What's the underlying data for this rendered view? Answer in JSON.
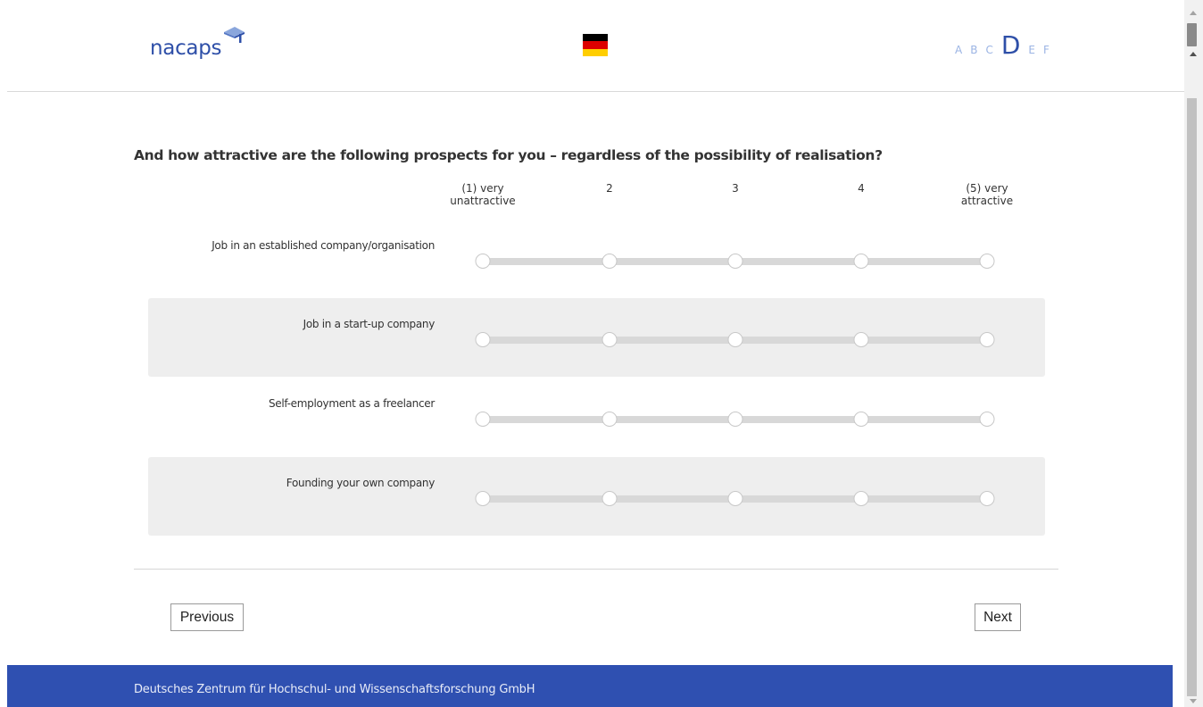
{
  "header": {
    "logo_text": "nacaps",
    "sections": [
      "A",
      "B",
      "C",
      "D",
      "E",
      "F"
    ],
    "active_section": "D",
    "flag_colors": [
      "#000000",
      "#dd0000",
      "#ffce00"
    ]
  },
  "question": {
    "text": "And how attractive are the following prospects for you – regardless of the possibility of realisation?",
    "scale": [
      {
        "line1": "(1) very",
        "line2": "unattractive"
      },
      {
        "line1": "2",
        "line2": ""
      },
      {
        "line1": "3",
        "line2": ""
      },
      {
        "line1": "4",
        "line2": ""
      },
      {
        "line1": "(5) very",
        "line2": "attractive"
      }
    ],
    "items": [
      {
        "label": "Job in an established company/organisation",
        "selected": null
      },
      {
        "label": "Job in a start-up company",
        "selected": null
      },
      {
        "label": "Self-employment as a freelancer",
        "selected": null
      },
      {
        "label": "Founding your own company",
        "selected": null
      }
    ]
  },
  "nav": {
    "previous_label": "Previous",
    "next_label": "Next"
  },
  "footer": {
    "text": "Deutsches Zentrum für Hochschul- und Wissenschaftsforschung GmbH"
  },
  "colors": {
    "brand_blue": "#2f50b1",
    "section_inactive": "#9bb4e4",
    "row_shade": "#eeeeee"
  }
}
